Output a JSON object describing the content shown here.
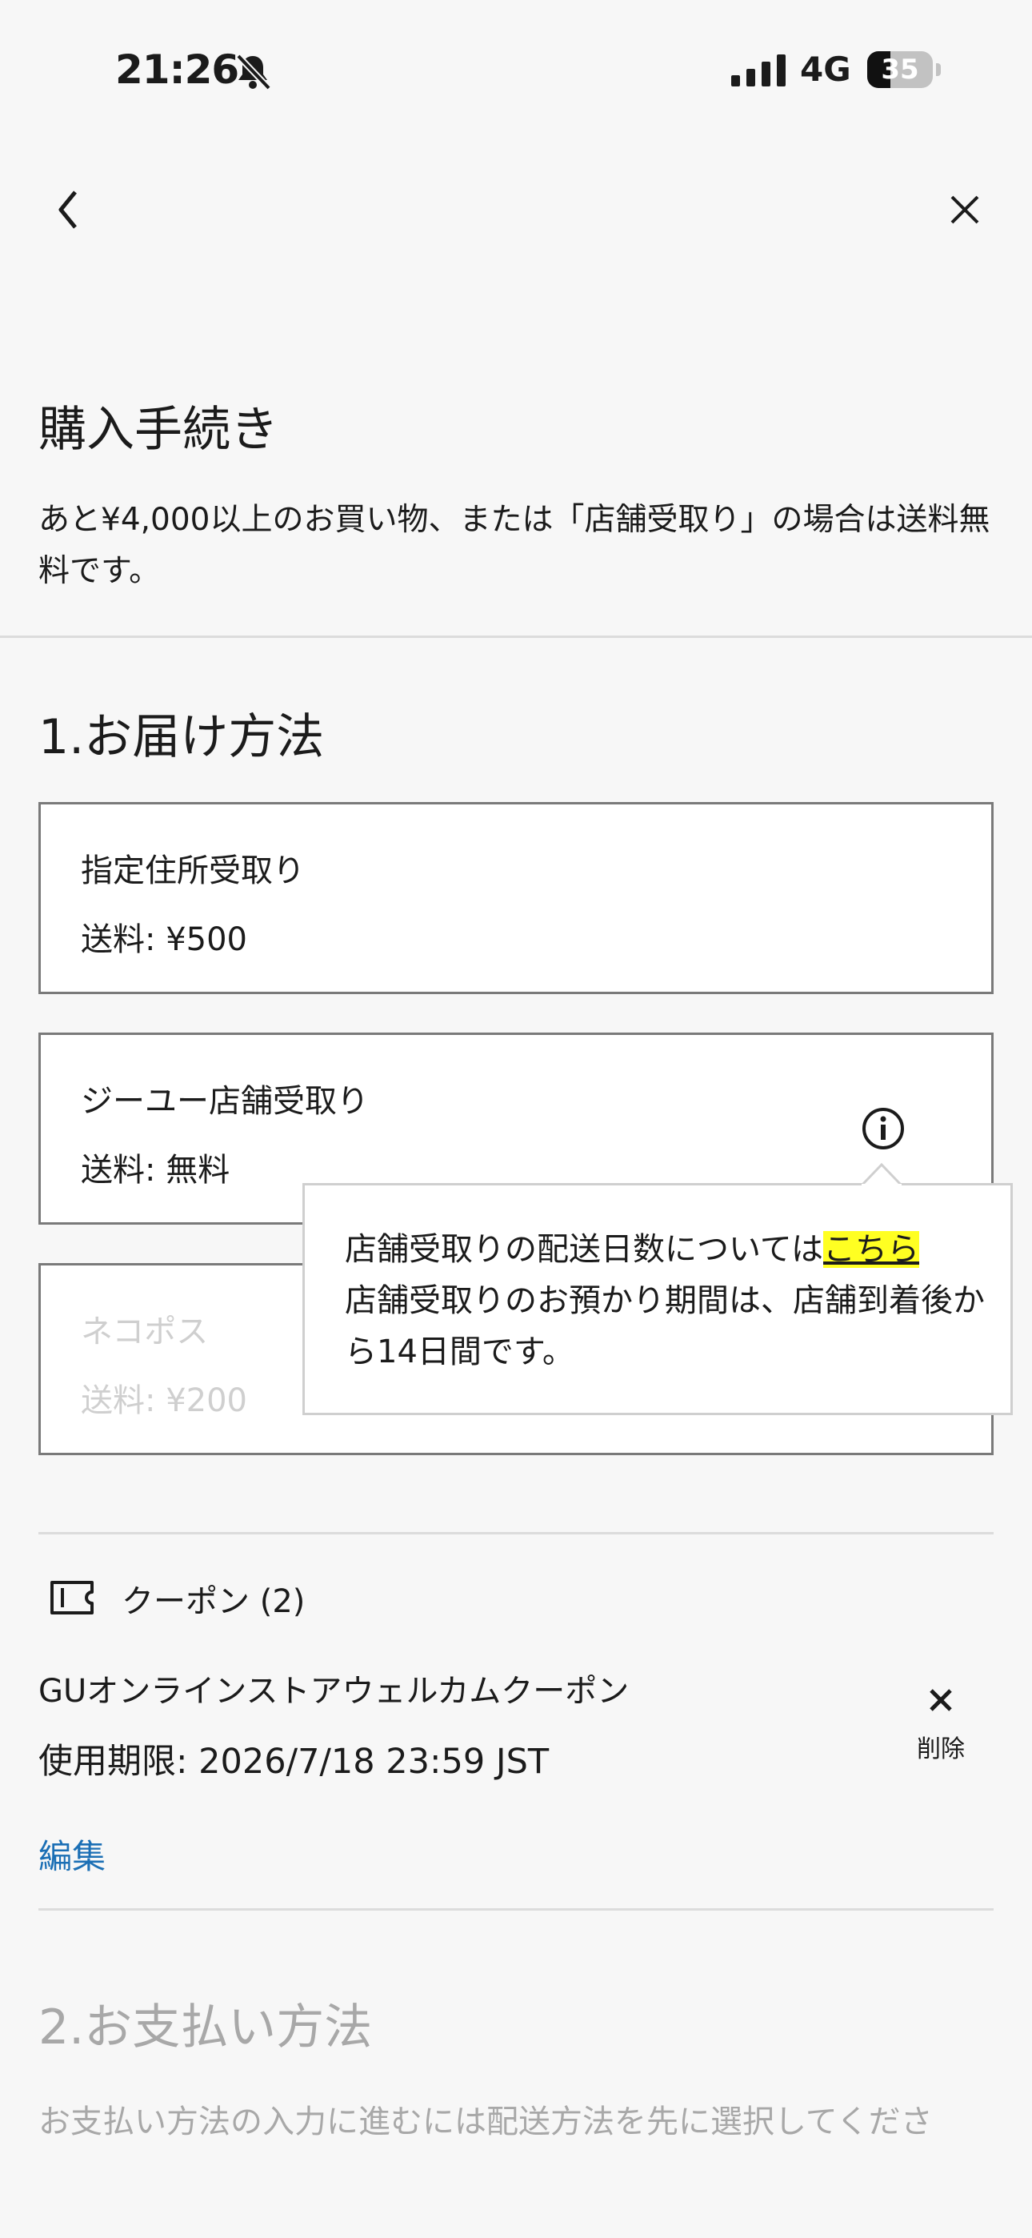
{
  "status_bar": {
    "time": "21:26",
    "network": "4G",
    "battery": "35",
    "battery_level": 0.35
  },
  "header": {
    "title": "購入手続き",
    "free_shipping_notice": "あと¥4,000以上のお買い物、または「店舗受取り」の場合は送料無料です。"
  },
  "delivery": {
    "section_title": "1.お届け方法",
    "options": [
      {
        "name": "指定住所受取り",
        "fee": "送料: ¥500"
      },
      {
        "name": "ジーユー店舗受取り",
        "fee": "送料: 無料"
      },
      {
        "name": "ネコポス",
        "fee": "送料: ¥200"
      }
    ],
    "popup": {
      "line1_prefix": "店舗受取りの配送日数については",
      "link_text": "こちら",
      "body": "店舗受取りのお預かり期間は、店舗到着後から14日間です。"
    }
  },
  "coupon": {
    "header": "クーポン (2)",
    "name": "GUオンラインストアウェルカムクーポン",
    "expiry": "使用期限: 2026/7/18 23:59 JST",
    "delete_label": "削除",
    "edit_label": "編集"
  },
  "payment": {
    "section_title": "2.お支払い方法",
    "note": "お支払い方法の入力に進むには配送方法を先に選択してくださ"
  }
}
